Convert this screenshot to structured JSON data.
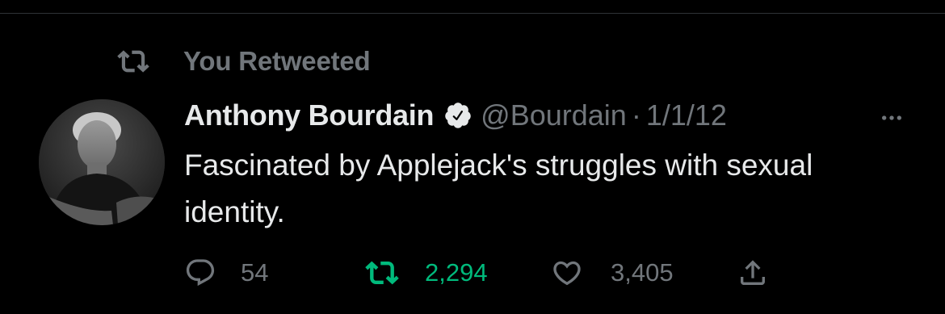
{
  "social_context": {
    "label": "You Retweeted",
    "icon": "retweet-icon"
  },
  "author": {
    "display_name": "Anthony Bourdain",
    "verified": true,
    "handle": "@Bourdain",
    "separator": "·",
    "date": "1/1/12"
  },
  "tweet": {
    "text": "Fascinated by Applejack's struggles with sexual identity."
  },
  "actions": {
    "reply_count": "54",
    "retweet_count": "2,294",
    "like_count": "3,405",
    "icons": [
      "reply-icon",
      "retweet-icon",
      "like-icon",
      "share-icon"
    ]
  },
  "colors": {
    "background": "#000000",
    "primary_text": "#e7e9ea",
    "secondary_text": "#71767b",
    "retweet_active": "#00ba7c"
  }
}
